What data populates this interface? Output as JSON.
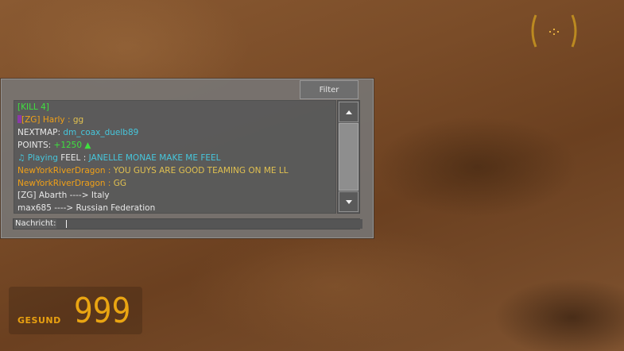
{
  "chat": {
    "filter_label": "Filter",
    "lines": [
      {
        "text": "[KILL 4]",
        "color": "#3fe03f"
      },
      {
        "prefix_icon": "purple-block-icon",
        "name": "[ZG] Harly : ",
        "message": "gg"
      },
      {
        "label": "NEXTMAP: ",
        "value": "dm_coax_duelb89"
      },
      {
        "label": "POINTS: ",
        "value": "+1250 ▲"
      },
      {
        "prefix": "♫ Playing ",
        "track_label": "FEEL : ",
        "track": "JANELLE MONAE MAKE ME FEEL"
      },
      {
        "name": "NewYorkRiverDragon : ",
        "message": "YOU GUYS ARE GOOD TEAMING ON ME LL"
      },
      {
        "name": "NewYorkRiverDragon : ",
        "message": "GG"
      },
      {
        "text": "[ZG] Abarth ----> Italy"
      },
      {
        "text": "max685 ----> Russian Federation"
      }
    ],
    "input_label": "Nachricht:",
    "input_value": ""
  },
  "hud": {
    "health_label": "GESUND",
    "health_value": "999"
  },
  "colors": {
    "hud_accent": "#eaa512",
    "system_green": "#3fe03f",
    "player_name": "#f0a018",
    "message_gold": "#e0c050",
    "info_cyan": "#46c6dc"
  }
}
